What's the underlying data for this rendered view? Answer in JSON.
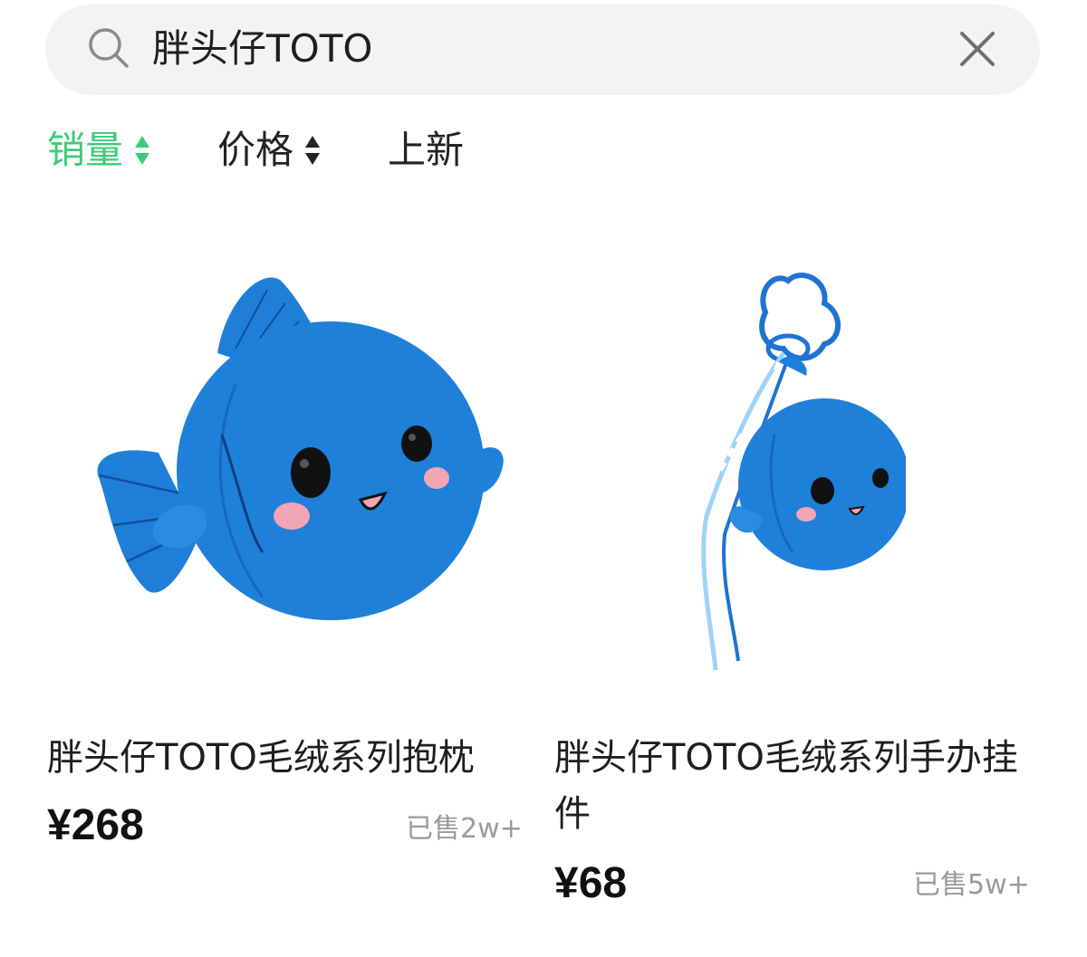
{
  "search": {
    "query": "胖头仔TOTO",
    "clear_icon": "close-icon",
    "search_icon": "search-icon"
  },
  "sort": {
    "items": [
      {
        "label": "销量",
        "active": true,
        "has_arrows": true
      },
      {
        "label": "价格",
        "active": false,
        "has_arrows": true
      },
      {
        "label": "上新",
        "active": false,
        "has_arrows": false
      }
    ],
    "active_color": "#3dcb7a"
  },
  "products": [
    {
      "title": "胖头仔TOTO毛绒系列抱枕",
      "price": "¥268",
      "sold": "已售2w+",
      "image": "blue-fish-plush-pillow"
    },
    {
      "title": "胖头仔TOTO毛绒系列手办挂件",
      "price": "¥68",
      "sold": "已售5w+",
      "image": "blue-fish-plush-keychain"
    }
  ],
  "colors": {
    "plush_blue": "#1e7fd6",
    "cheek_pink": "#f2a5b4"
  }
}
